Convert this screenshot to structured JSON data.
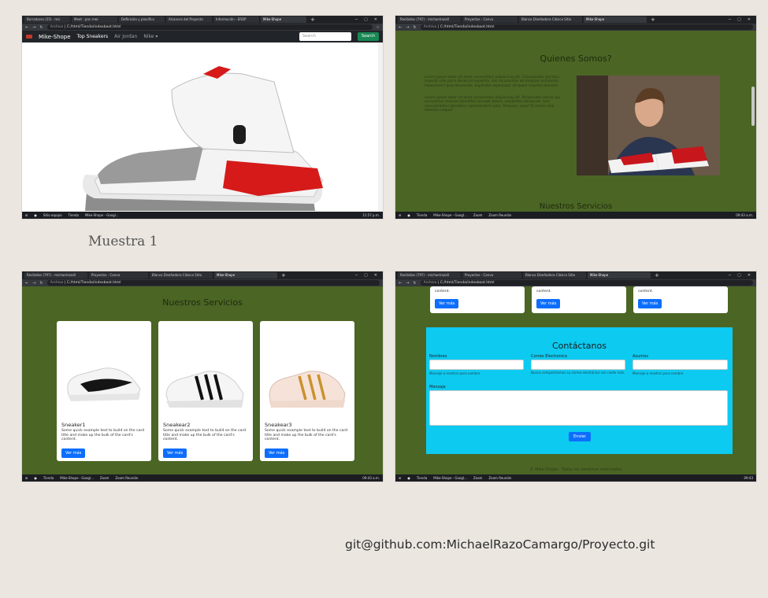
{
  "caption": "Muestra 1",
  "git_url": "git@github.com:MichaelRazoCamargo/Proyecto.git",
  "shot1": {
    "tabs": [
      "Borradores (55) - mic",
      "Meet - pnc-rrwi-",
      "Definición y planifica",
      "Alcances del Proyecto",
      "Información - ERDP",
      "Mike-Shope"
    ],
    "url": "C:/html/Tienda/indexboot.html",
    "url_prefix": "Archivo",
    "brand": "Mike-Shope",
    "nav_items": [
      "Top Sneakers",
      "Air Jordan",
      "Nike ▾"
    ],
    "search_placeholder": "Search",
    "search_button": "Search",
    "taskbar_left": "Sitio equipo",
    "taskbar_mid": "Tienda",
    "taskbar_app": "Mike-Shope - Googl...",
    "taskbar_time": "11:57 p.m."
  },
  "shot2": {
    "tabs": [
      "Recibidos (797) - michaelrazo0",
      "Proyectos - Canva",
      "Blanco Diseñadora Clásico Sitio",
      "Mike-Shope"
    ],
    "url": "C:/html/Tienda/indexboot.html",
    "url_prefix": "Archivo",
    "heading": "Quienes Somos?",
    "para1": "Lorem ipsum dolor sit amet consectetur adipisicing elit. Consequatur pariatur, impedit odio porro deserunt expedita, nisi recusandae ab tempore architecto laboriosam! Ipsa desenrolla. Explicabo aspernatur sit quam maxime dolorem.",
    "para2": "Lorem ipsum dolor sit amet consectetur adipisicing elit. Perspiciatis earum qui accusamus maiores blanditiis corrupti dolore, voluptates obcaecati. Iure necessitatibus blanditiis reprehenderit iusto. Tempore, esse? Et omnis nihil delectus neque?",
    "heading2": "Nuestros Servicios",
    "taskbar_mid": "Tienda",
    "taskbar_app": "Mike-Shope - Googl...",
    "taskbar_zoom": "Zoom",
    "taskbar_zoom2": "Zoom Reunión",
    "taskbar_time": "09:43 a.m."
  },
  "shot3": {
    "tabs": [
      "Recibidos (797) - michaelrazo0",
      "Proyectos - Canva",
      "Blanco Diseñadora Clásico Sitio",
      "Mike-Shope"
    ],
    "url": "C:/html/Tienda/indexboot.html",
    "url_prefix": "Archivo",
    "heading": "Nuestros Servicios",
    "cards": [
      {
        "title": "Sneaker1",
        "text": "Some quick example text to build on the card title and make up the bulk of the card's content.",
        "button": "Ver más"
      },
      {
        "title": "Sneakear2",
        "text": "Some quick example text to build on the card title and make up the bulk of the card's content.",
        "button": "Ver más"
      },
      {
        "title": "Sneakear3",
        "text": "Some quick example text to build on the card title and make up the bulk of the card's content.",
        "button": "Ver más"
      }
    ],
    "taskbar_mid": "Tienda",
    "taskbar_app": "Mike-Shope - Googl...",
    "taskbar_zoom": "Zoom",
    "taskbar_zoom2": "Zoom Reunión",
    "taskbar_time": "09:43 a.m."
  },
  "shot4": {
    "tabs": [
      "Recibidos (797) - michaelrazo0",
      "Proyectos - Canva",
      "Blanco Diseñadora Clásico Sitio",
      "Mike-Shope"
    ],
    "url": "C:/html/Tienda/indexboot.html",
    "url_prefix": "Archivo",
    "top_text": "content.",
    "top_button": "Ver más",
    "contact_title": "Contáctanos",
    "fields": [
      {
        "label": "Nombres",
        "help": "Mensaje a mostrar para nombre"
      },
      {
        "label": "Correo Electronico",
        "help": "Nunca compartiremos su correo electrónico con nadie más."
      },
      {
        "label": "Asuntos",
        "help": "Mensaje a mostrar para nombre"
      }
    ],
    "message_label": "Mensaje",
    "send_button": "Enviar",
    "footer": "© Mike-Shope - Todos los derechos reservados",
    "taskbar_mid": "Tienda",
    "taskbar_app": "Mike-Shope - Googl...",
    "taskbar_zoom": "Zoom",
    "taskbar_zoom2": "Zoom Reunión",
    "taskbar_time": "09:43"
  },
  "colors": {
    "olive": "#4b6524",
    "cyan": "#0dcaf0",
    "blue": "#0d6efd",
    "green": "#198754"
  }
}
